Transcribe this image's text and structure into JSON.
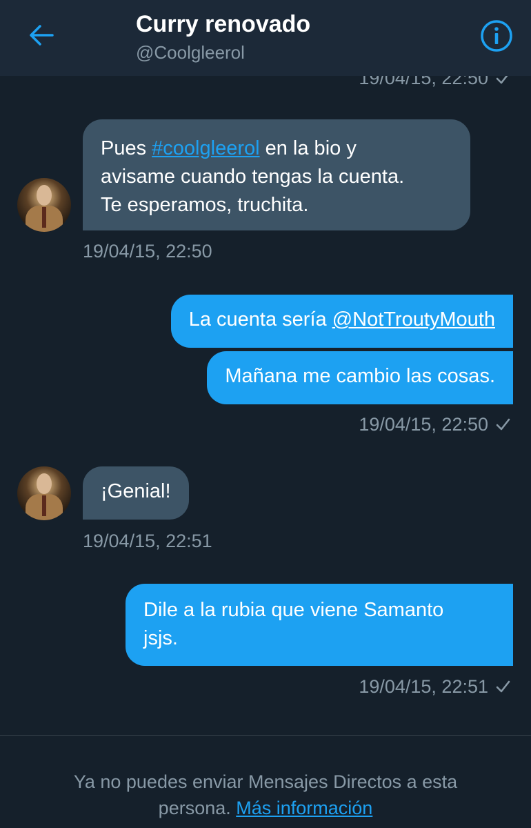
{
  "header": {
    "title": "Curry renovado",
    "handle": "@Coolgleerol",
    "back_icon": "arrow-left-icon",
    "info_icon": "info-icon",
    "accent": "#1da1f2"
  },
  "messages": {
    "prev_timestamp": "19/04/15, 22:50",
    "m1": {
      "line1_a": "Pues ",
      "line1_link": "#coolgleerol",
      "line1_b": " en la bio y",
      "line2": "avisame cuando tengas la cuenta.",
      "line3": "Te esperamos, truchita.",
      "timestamp": "19/04/15, 22:50"
    },
    "m2": {
      "text_a": "La cuenta sería ",
      "text_link": "@NotTroutyMouth"
    },
    "m3": {
      "text": "Mañana me cambio las cosas.",
      "timestamp": "19/04/15, 22:50"
    },
    "m4": {
      "text": "¡Genial!",
      "timestamp": "19/04/15, 22:51"
    },
    "m5": {
      "line1": "Dile a la rubia que viene Samanto",
      "line2": "jsjs.",
      "timestamp": "19/04/15, 22:51"
    }
  },
  "footer": {
    "line1": "Ya no puedes enviar Mensajes Directos a esta",
    "line2_a": "persona. ",
    "line2_link": "Más información"
  },
  "colors": {
    "background": "#15202b",
    "header_bg": "#1c2938",
    "incoming_bubble": "#3d5466",
    "outgoing_bubble": "#1da1f2",
    "muted_text": "#8899a6"
  }
}
